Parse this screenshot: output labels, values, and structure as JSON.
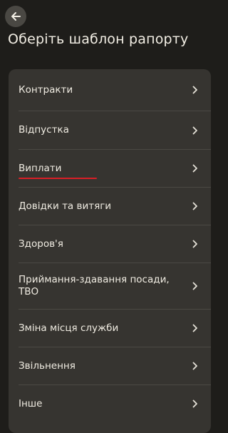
{
  "header": {
    "back_icon": "arrow-left-icon",
    "title": "Оберіть шаблон рапорту"
  },
  "menu": {
    "items": [
      {
        "label": "Контракти"
      },
      {
        "label": "Відпустка"
      },
      {
        "label": "Виплати"
      },
      {
        "label": "Довідки та витяги"
      },
      {
        "label": "Здоров'я"
      },
      {
        "label": "Приймання-здавання посади, ТВО"
      },
      {
        "label": "Зміна місця служби"
      },
      {
        "label": "Звільнення"
      },
      {
        "label": "Інше"
      }
    ],
    "chevron_icon": "chevron-right-icon",
    "underline_color": "#d91f26"
  }
}
